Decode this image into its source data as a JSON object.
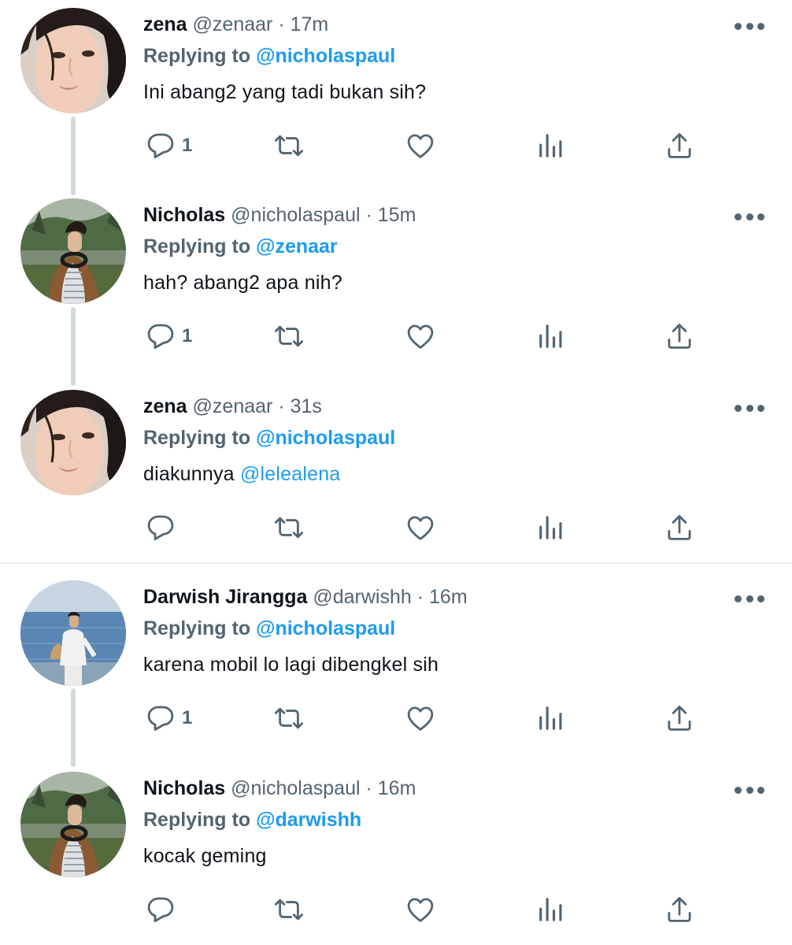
{
  "colors": {
    "text": "#0f1419",
    "muted": "#536471",
    "link": "#1d9bf0",
    "divider": "#e6ecf0",
    "thread": "#cfd9de"
  },
  "icons": [
    "reply-icon",
    "retweet-icon",
    "like-icon",
    "analytics-icon",
    "share-icon",
    "more-icon"
  ],
  "tweets": [
    {
      "name": "zena",
      "handle": "@zenaar",
      "time": "17m",
      "replying_label": "Replying to",
      "replying_to": "@nicholaspaul",
      "text": "Ini abang2 yang tadi bukan sih?",
      "reply_count": "1"
    },
    {
      "name": "Nicholas",
      "handle": "@nicholaspaul",
      "time": "15m",
      "replying_label": "Replying to",
      "replying_to": "@zenaar",
      "text": "hah? abang2 apa nih?",
      "reply_count": "1"
    },
    {
      "name": "zena",
      "handle": "@zenaar",
      "time": "31s",
      "replying_label": "Replying to",
      "replying_to": "@nicholaspaul",
      "text": "diakunnya ",
      "text_mention": "@lelealena",
      "reply_count": ""
    },
    {
      "name": "Darwish Jirangga",
      "handle": "@darwishh",
      "time": "16m",
      "replying_label": "Replying to",
      "replying_to": "@nicholaspaul",
      "text": "karena mobil lo lagi dibengkel sih",
      "reply_count": "1"
    },
    {
      "name": "Nicholas",
      "handle": "@nicholaspaul",
      "time": "16m",
      "replying_label": "Replying to",
      "replying_to": "@darwishh",
      "text": "kocak geming",
      "reply_count": ""
    }
  ]
}
